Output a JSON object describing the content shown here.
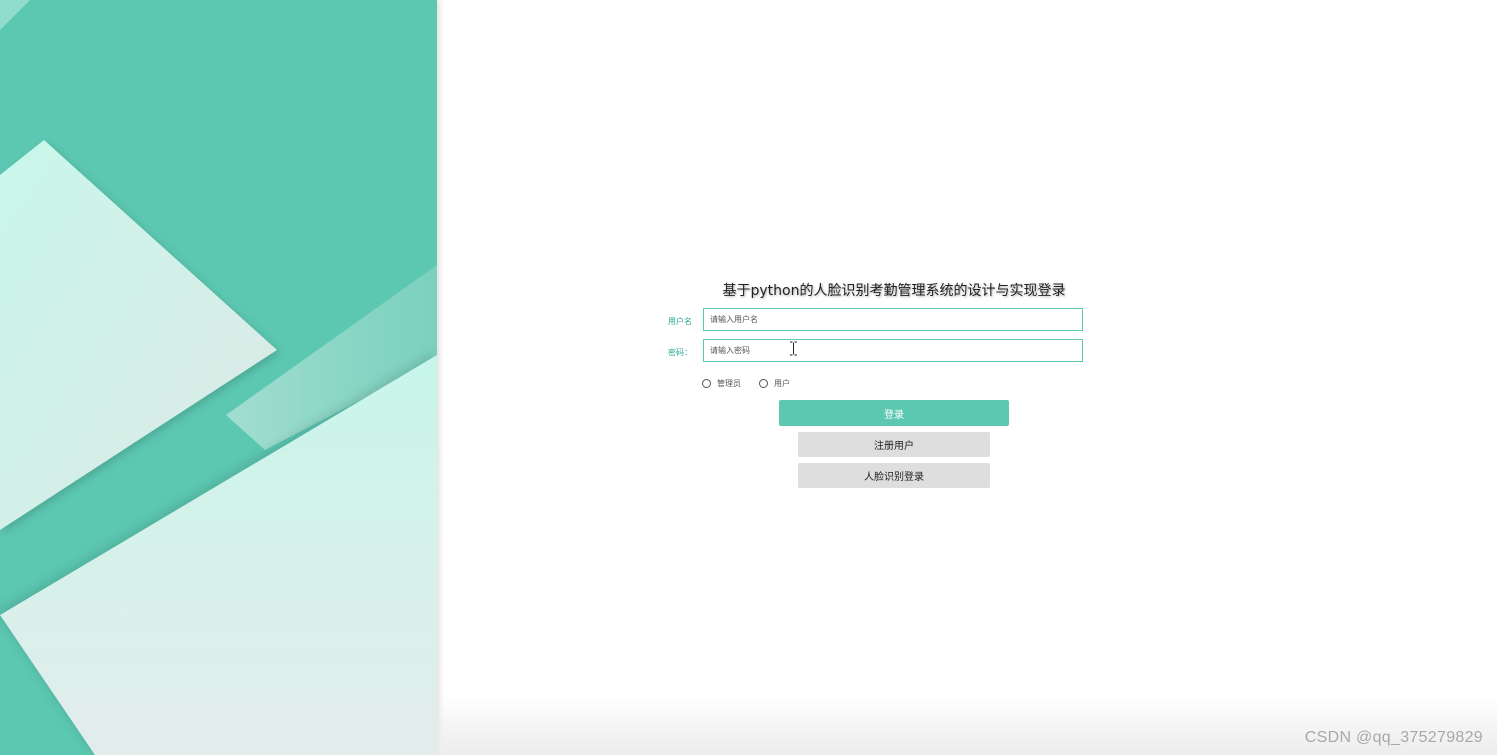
{
  "login": {
    "title": "基于python的人脸识别考勤管理系统的设计与实现登录",
    "username_label": "用户名",
    "username_placeholder": "请输入用户名",
    "password_label": "密码：",
    "password_placeholder": "请输入密码",
    "roles": [
      {
        "label": "管理员",
        "selected": false
      },
      {
        "label": "用户",
        "selected": false
      }
    ],
    "login_button": "登录",
    "register_button": "注册用户",
    "face_login_button": "人脸识别登录"
  },
  "watermark": "CSDN @qq_375279829",
  "colors": {
    "accent": "#5cc8b2",
    "panel_light": "#c8f5ea",
    "button_gray": "#dedede"
  },
  "icons": {
    "cursor": "text-cursor-icon"
  }
}
